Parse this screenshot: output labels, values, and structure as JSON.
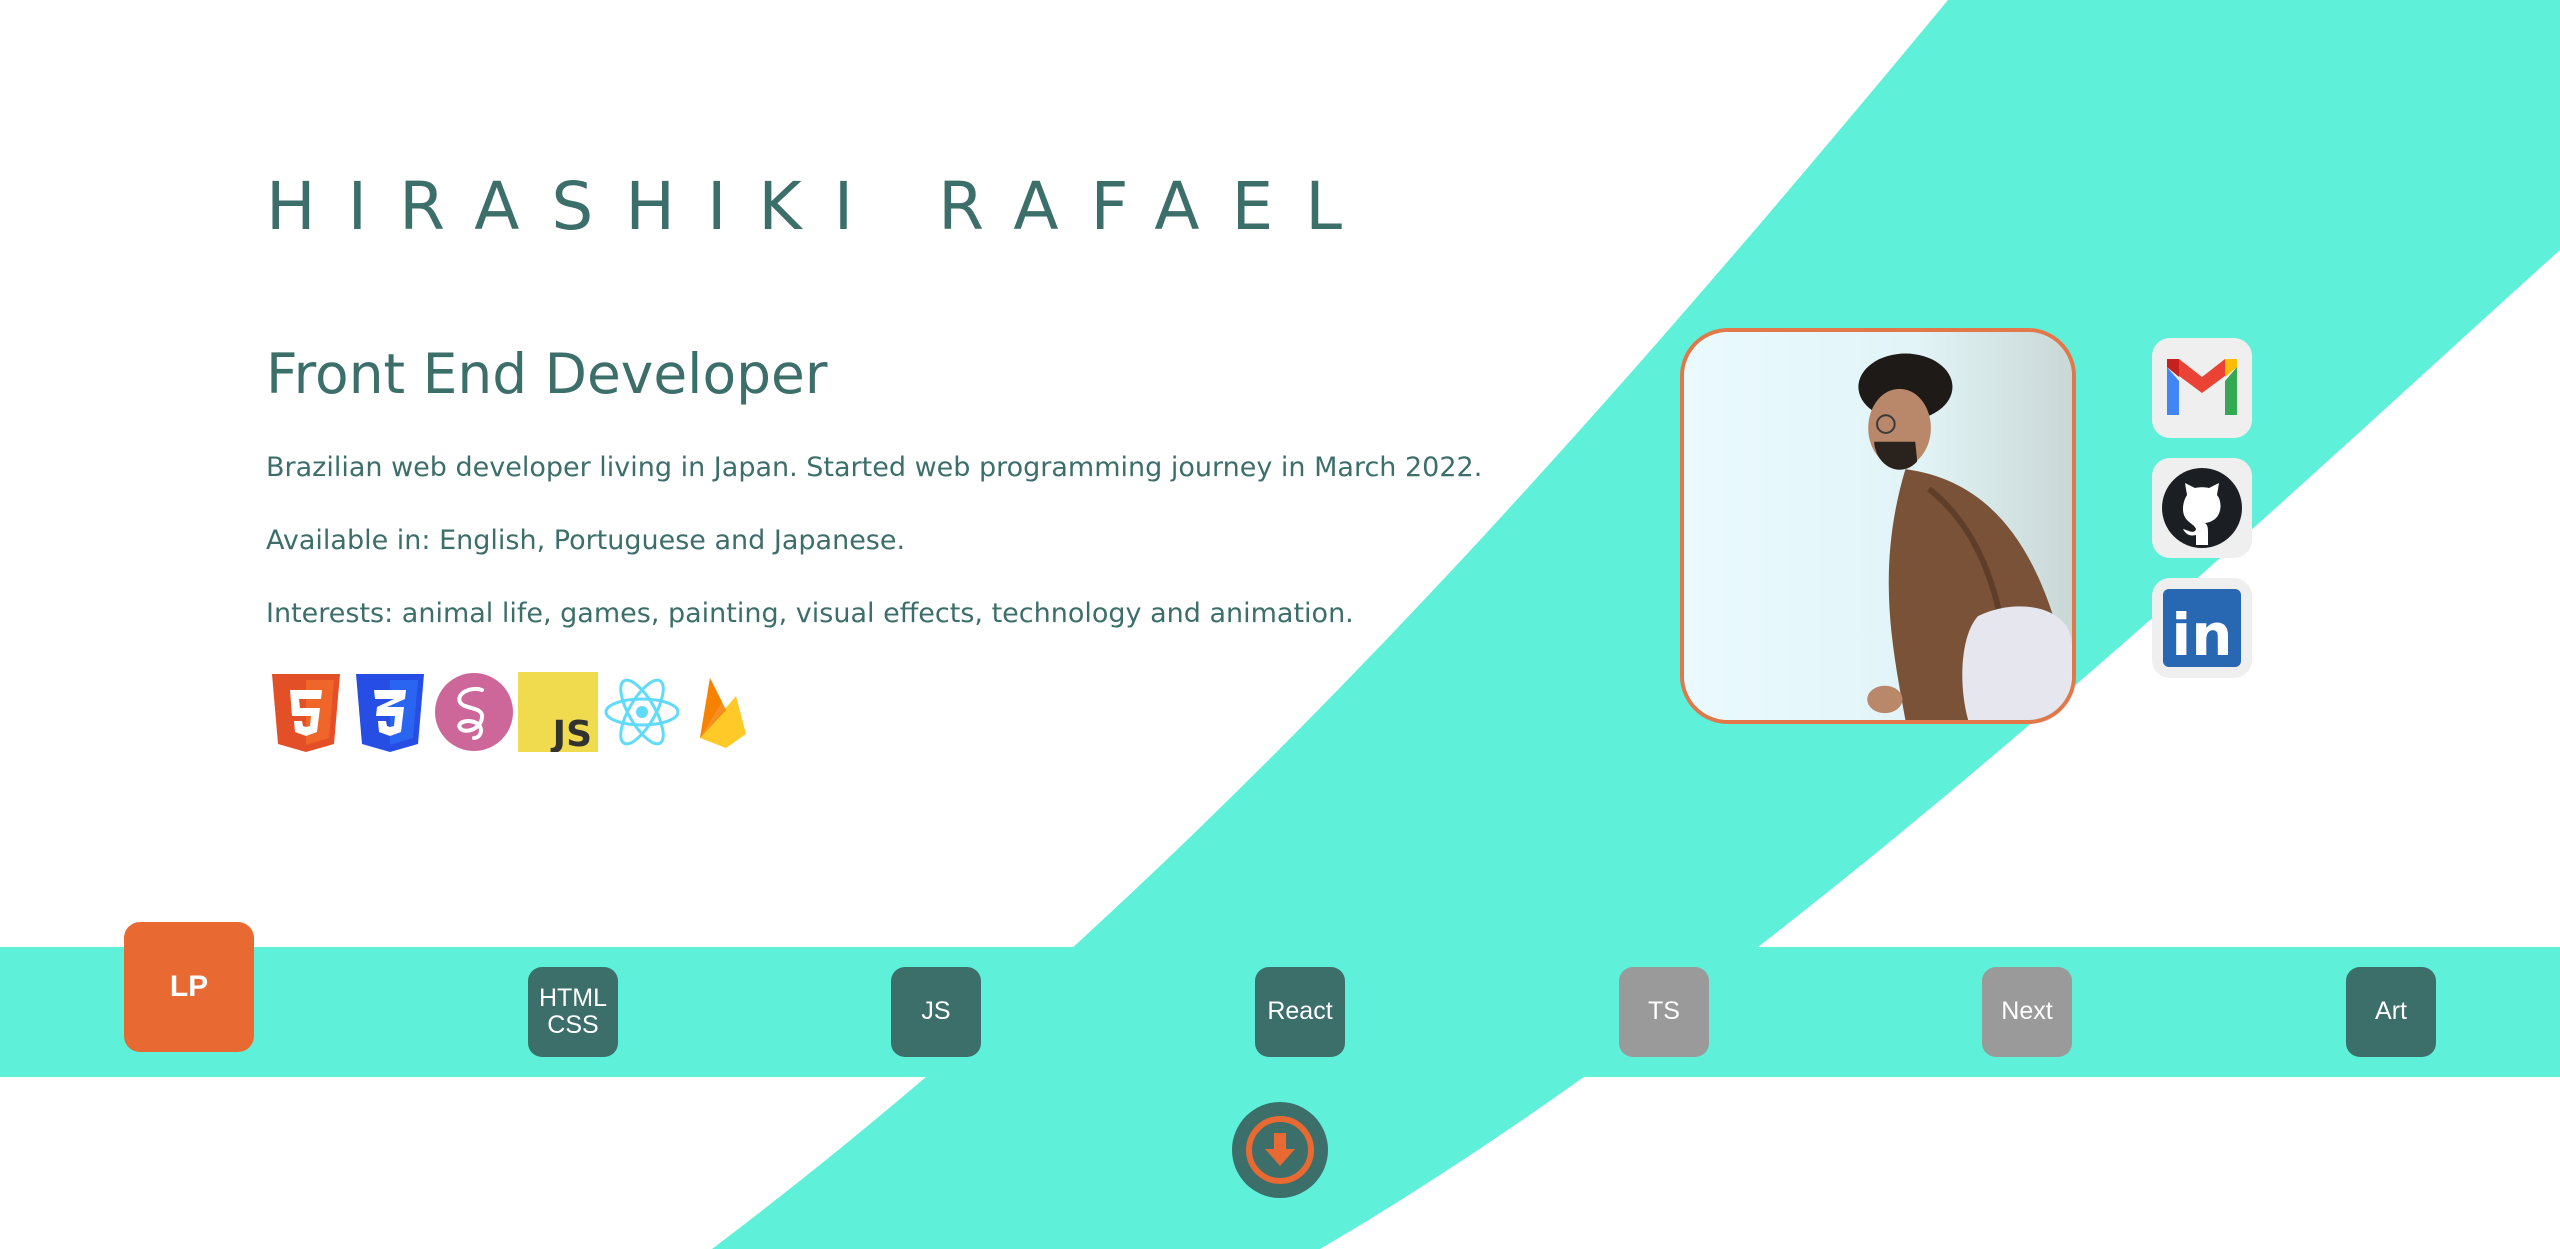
{
  "header": {
    "name": "HIRASHIKI RAFAEL",
    "role": "Front End Developer"
  },
  "bio": {
    "line1": "Brazilian web developer living in Japan. Started web programming journey in March 2022.",
    "line2": "Available in: English, Portuguese and Japanese.",
    "line3": "Interests: animal life, games, painting, visual effects, technology and animation."
  },
  "tech_icons": [
    "html5-icon",
    "css3-icon",
    "sass-icon",
    "javascript-icon",
    "react-icon",
    "firebase-icon"
  ],
  "tech_labels": {
    "js": "JS"
  },
  "social": [
    "gmail-icon",
    "github-icon",
    "linkedin-icon"
  ],
  "social_labels": {
    "linkedin": "in"
  },
  "projects": {
    "lp": "LP",
    "html_css": "HTML\nCSS",
    "js": "JS",
    "react": "React",
    "ts": "TS",
    "next": "Next",
    "art": "Art"
  },
  "colors": {
    "accent_teal": "#5ef0d8",
    "text_teal": "#3c6e6a",
    "accent_orange": "#e86a32",
    "inactive_gray": "#9a9a9a"
  }
}
